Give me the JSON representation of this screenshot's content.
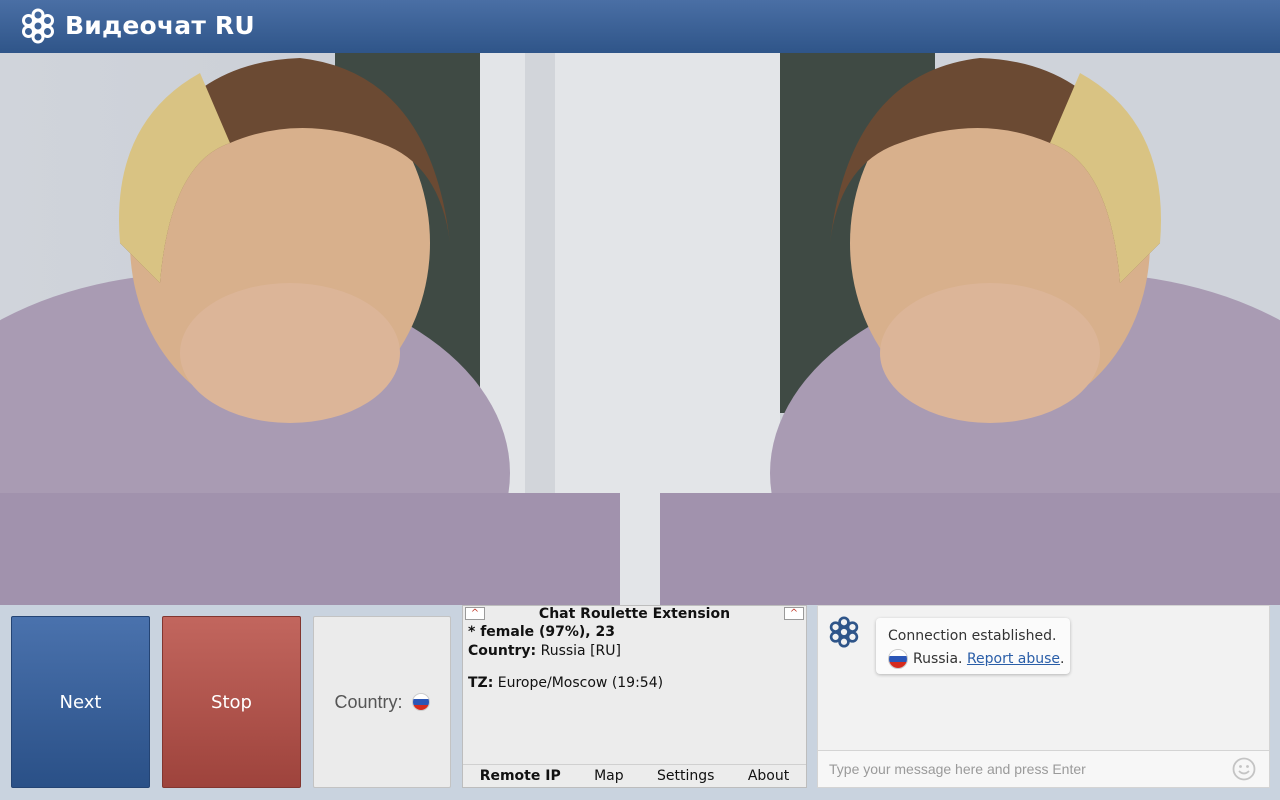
{
  "app": {
    "title": "Видеочат RU"
  },
  "controls": {
    "next_label": "Next",
    "stop_label": "Stop",
    "country_label": "Country:",
    "country_flag": "russia-flag"
  },
  "extension": {
    "title": "Chat Roulette Extension",
    "collapse_symbol": "^",
    "gender_line": "* female (97%), 23",
    "country_key": "Country:",
    "country_value": " Russia [RU]",
    "tz_key": "TZ:",
    "tz_value": " Europe/Moscow (19:54)",
    "tabs": [
      {
        "label": "Remote IP",
        "active": true
      },
      {
        "label": "Map",
        "active": false
      },
      {
        "label": "Settings",
        "active": false
      },
      {
        "label": "About",
        "active": false
      }
    ]
  },
  "chat": {
    "status": "Connection established.",
    "country": "Russia.",
    "report_link": "Report abuse",
    "report_suffix": ".",
    "input_placeholder": "Type your message here and press Enter"
  },
  "colors": {
    "header": "#3b619a",
    "next_button": "#3a619b",
    "stop_button": "#b0554e",
    "link": "#2a5ea8"
  }
}
